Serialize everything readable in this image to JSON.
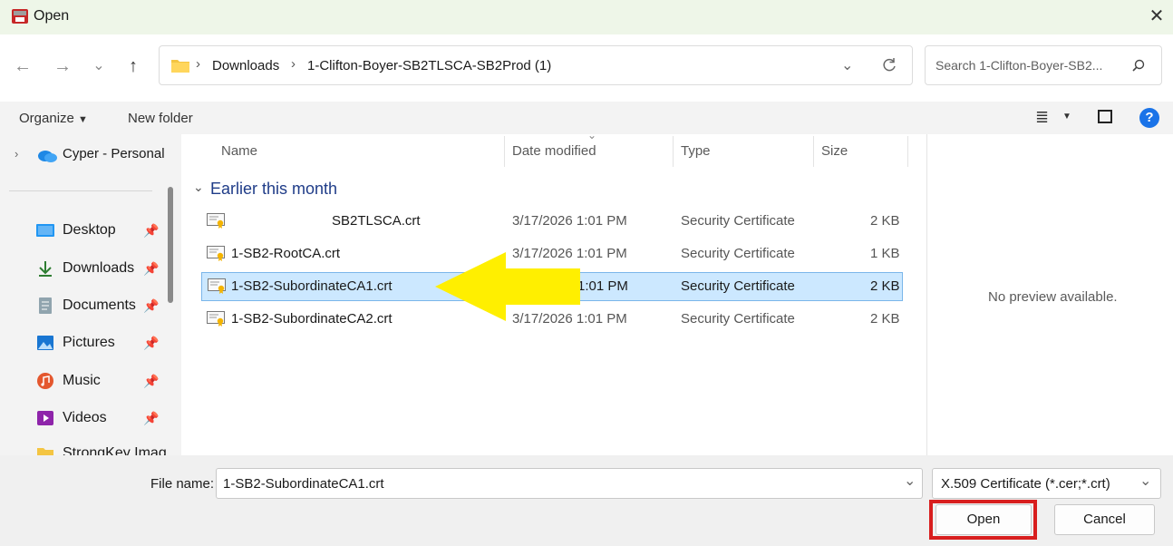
{
  "window": {
    "title": "Open",
    "close_glyph": "✕"
  },
  "nav": {
    "back": "←",
    "forward": "→",
    "recent": "⌄",
    "up": "↑"
  },
  "address": {
    "segments": [
      "Downloads",
      "1-Clifton-Boyer-SB2TLSCA-SB2Prod (1)"
    ],
    "sep": "›"
  },
  "search": {
    "placeholder": "Search 1-Clifton-Boyer-SB2..."
  },
  "toolbar": {
    "organize": "Organize",
    "new_folder": "New folder"
  },
  "sidebar": {
    "top_item": "Cyper - Personal",
    "items": [
      {
        "label": "Desktop",
        "icon": "desktop-icon"
      },
      {
        "label": "Downloads",
        "icon": "download-icon"
      },
      {
        "label": "Documents",
        "icon": "documents-icon"
      },
      {
        "label": "Pictures",
        "icon": "pictures-icon"
      },
      {
        "label": "Music",
        "icon": "music-icon"
      },
      {
        "label": "Videos",
        "icon": "videos-icon"
      },
      {
        "label": "StrongKey Imag",
        "icon": "folder-icon"
      }
    ]
  },
  "columns": {
    "name": "Name",
    "date": "Date modified",
    "type": "Type",
    "size": "Size"
  },
  "group": {
    "label": "Earlier this month"
  },
  "files": [
    {
      "name": "SB2TLSCA.crt",
      "date": "3/17/2026 1:01 PM",
      "type": "Security Certificate",
      "size": "2 KB"
    },
    {
      "name": "1-SB2-RootCA.crt",
      "date": "3/17/2026 1:01 PM",
      "type": "Security Certificate",
      "size": "1 KB"
    },
    {
      "name": "1-SB2-SubordinateCA1.crt",
      "date": "1:01 PM",
      "type": "Security Certificate",
      "size": "2 KB"
    },
    {
      "name": "1-SB2-SubordinateCA2.crt",
      "date": "3/17/2026 1:01 PM",
      "type": "Security Certificate",
      "size": "2 KB"
    }
  ],
  "preview": {
    "text": "No preview available."
  },
  "footer": {
    "file_name_label": "File name:",
    "file_name_value": "1-SB2-SubordinateCA1.crt",
    "file_type": "X.509 Certificate (*.cer;*.crt)",
    "open": "Open",
    "cancel": "Cancel"
  },
  "colors": {
    "selection": "#cce8ff",
    "annotation_arrow": "#ffef00",
    "highlight_box": "#d81e1e",
    "group_heading": "#1f3c88"
  }
}
